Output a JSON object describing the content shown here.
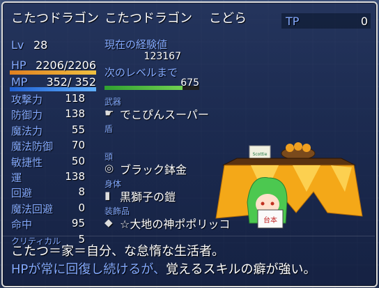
{
  "header": {
    "name": "こたつドラゴン",
    "class": "こたつドラゴン",
    "nickname": "こどら",
    "tp_label": "TP",
    "tp_value": "0"
  },
  "status": {
    "level_label": "Lv",
    "level_value": "28",
    "hp_label": "HP",
    "hp_value": "2206/2206",
    "hp_ratio": 1.0,
    "mp_label": "MP",
    "mp_value": "352/ 352",
    "mp_ratio": 1.0
  },
  "exp": {
    "current_label": "現在の経験値",
    "current_value": "123167",
    "next_label": "次のレベルまで",
    "next_value": "675",
    "next_ratio": 0.82
  },
  "params": [
    {
      "label": "攻撃力",
      "value": "118"
    },
    {
      "label": "防御力",
      "value": "138"
    },
    {
      "label": "魔法力",
      "value": "55"
    },
    {
      "label": "魔法防御",
      "value": "70"
    },
    {
      "label": "敏捷性",
      "value": "50"
    },
    {
      "label": "運",
      "value": "138"
    },
    {
      "label": "回避",
      "value": "8"
    },
    {
      "label": "魔法回避",
      "value": "0"
    },
    {
      "label": "命中",
      "value": "95"
    },
    {
      "label": "クリティカル",
      "value": "5"
    }
  ],
  "equipment": [
    {
      "slot": "武器",
      "item": "でこぴんスーパー",
      "icon": "pointing-hand-icon"
    },
    {
      "slot": "盾",
      "item": "",
      "icon": ""
    },
    {
      "slot": "頭",
      "item": "ブラック鉢金",
      "icon": "headband-icon"
    },
    {
      "slot": "身体",
      "item": "黒獅子の鎧",
      "icon": "armor-icon"
    },
    {
      "slot": "装飾品",
      "item": "☆大地の神ポポリッコ",
      "icon": "cat-charm-icon"
    }
  ],
  "portrait": {
    "sign_text": "台本",
    "box_text": "Scottie"
  },
  "description": {
    "line1": "こたつ＝家＝自分、な怠惰な生活者。",
    "line2_highlight": "HPが常に回復し続けるが、",
    "line2_rest": "覚えるスキルの癖が強い。"
  },
  "colors": {
    "system": "#84aaff",
    "hp_start": "#e08020",
    "hp_end": "#f0c040",
    "mp_start": "#2060d0",
    "mp_end": "#60b0ff",
    "exp_start": "#30a030",
    "exp_end": "#70d050"
  }
}
